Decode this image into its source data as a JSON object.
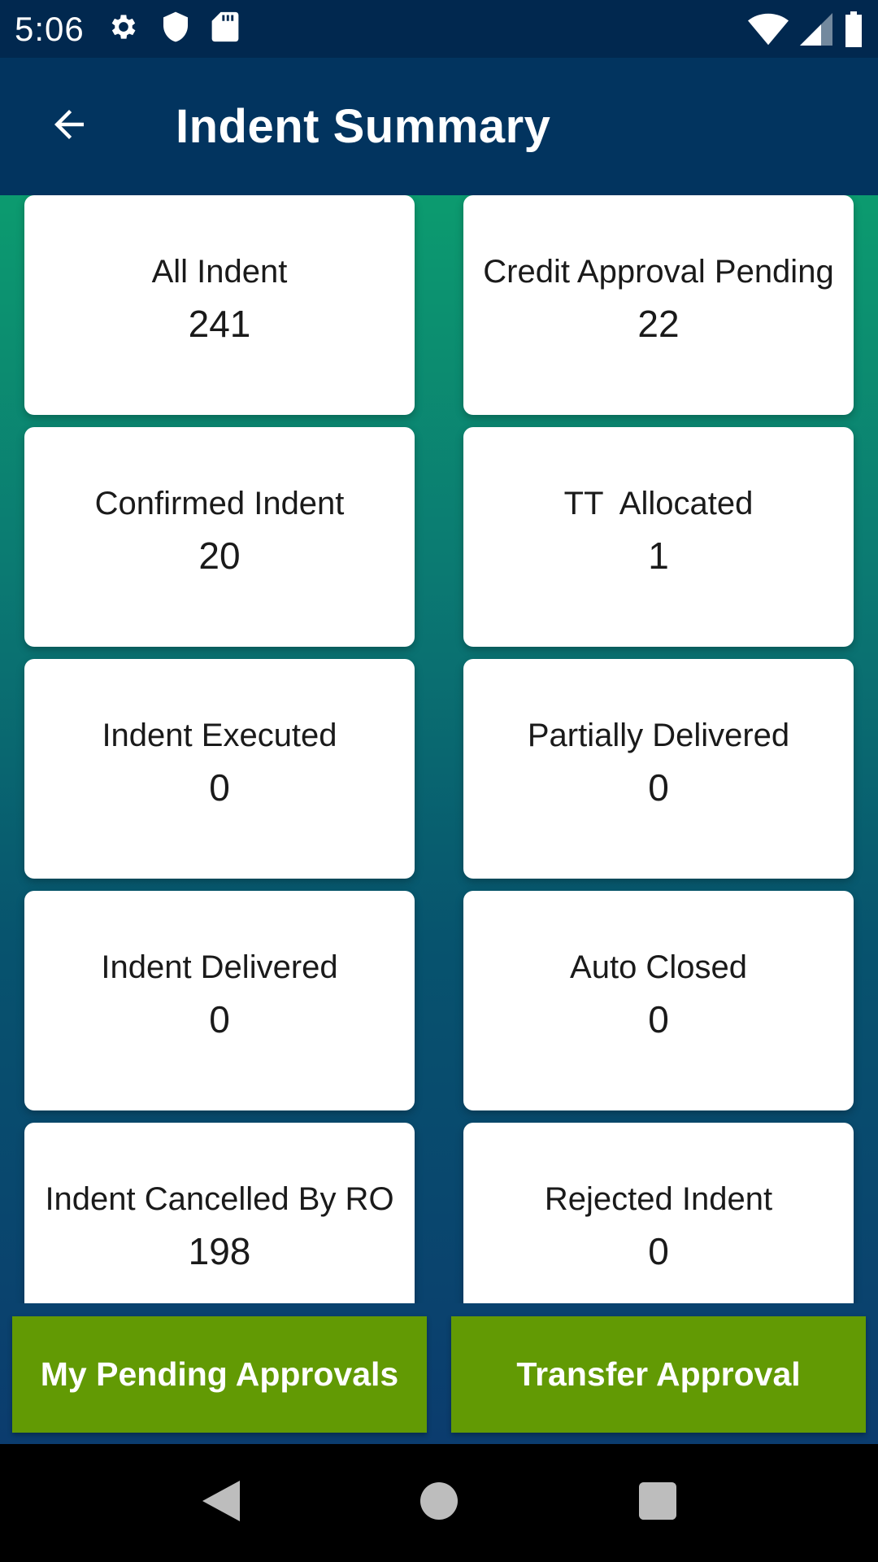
{
  "status_bar": {
    "time": "5:06",
    "icons_left": [
      "gear-icon",
      "shield-icon",
      "sd-card-icon"
    ],
    "icons_right": [
      "wifi-icon",
      "cell-signal-icon",
      "battery-icon"
    ]
  },
  "app_bar": {
    "title": "Indent Summary",
    "back_icon": "arrow-back-icon"
  },
  "cards": [
    {
      "label": "All Indent",
      "count": "241"
    },
    {
      "label": "Credit Approval Pending",
      "count": "22"
    },
    {
      "label": "Confirmed Indent",
      "count": "20"
    },
    {
      "label": "TT  Allocated",
      "count": "1"
    },
    {
      "label": "Indent Executed",
      "count": "0"
    },
    {
      "label": "Partially Delivered",
      "count": "0"
    },
    {
      "label": "Indent Delivered",
      "count": "0"
    },
    {
      "label": "Auto Closed",
      "count": "0"
    },
    {
      "label": "Indent Cancelled By RO",
      "count": "198"
    },
    {
      "label": "Rejected Indent",
      "count": "0"
    }
  ],
  "buttons": {
    "pending": "My Pending Approvals",
    "transfer": "Transfer Approval"
  },
  "colors": {
    "app_bar": "#02345f",
    "status_bar": "#01284f",
    "button": "#629a04",
    "gradient_top": "#0c9b6f",
    "gradient_bottom": "#0b3c6e"
  },
  "nav_bar": [
    "back-triangle-icon",
    "home-circle-icon",
    "recents-square-icon"
  ]
}
